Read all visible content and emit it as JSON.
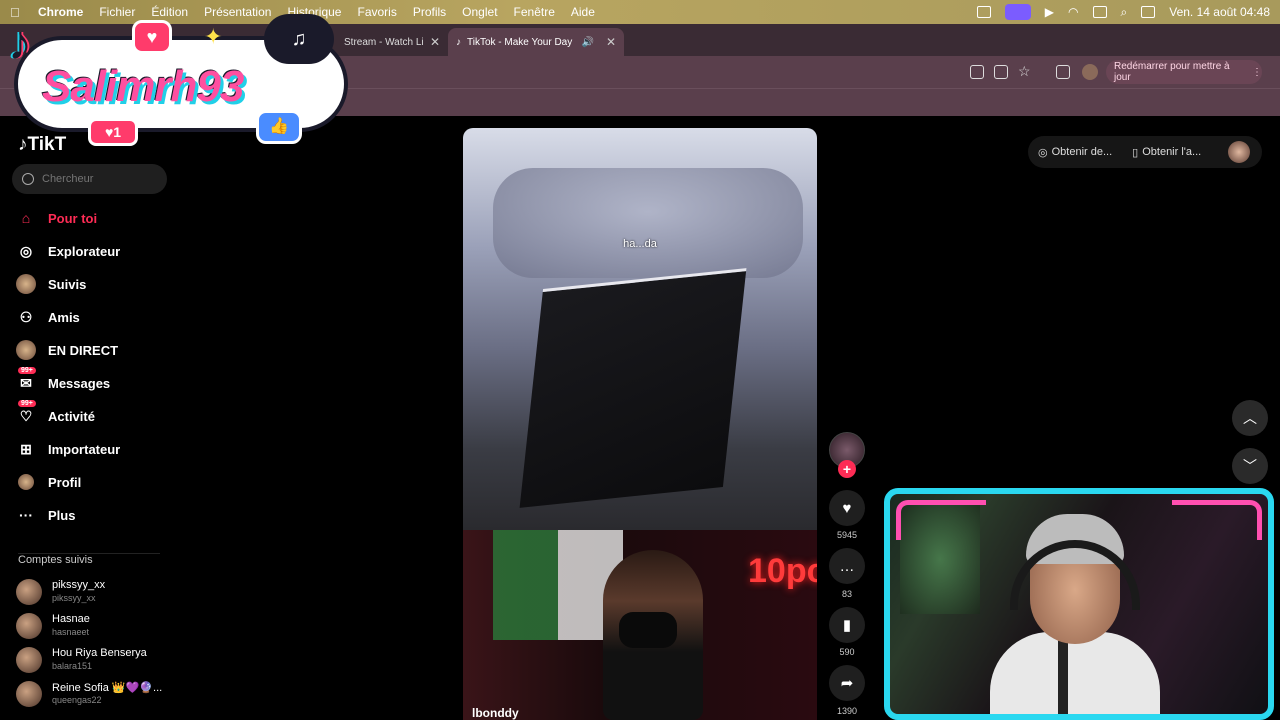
{
  "menubar": {
    "app": "Chrome",
    "items": [
      "Fichier",
      "Édition",
      "Présentation",
      "Historique",
      "Favoris",
      "Profils",
      "Onglet",
      "Fenêtre",
      "Aide"
    ],
    "clock": "Ven. 14 août  04:48"
  },
  "browser": {
    "tabs": [
      {
        "title": "Stream - Watch Li"
      },
      {
        "title": "TikTok - Make Your Day"
      }
    ],
    "relaunch_label": "Redémarrer pour mettre à jour"
  },
  "overlay": {
    "streamer_name": "Salimrh93",
    "like_count": "1"
  },
  "tiktok": {
    "logo": "TikT",
    "search_placeholder": "Chercheur",
    "nav": [
      {
        "label": "Pour toi",
        "icon": "home-icon"
      },
      {
        "label": "Explorateur",
        "icon": "compass-icon"
      },
      {
        "label": "Suivis",
        "icon": "following-avatar-icon"
      },
      {
        "label": "Amis",
        "icon": "friends-icon"
      },
      {
        "label": "EN DIRECT",
        "icon": "live-icon"
      },
      {
        "label": "Messages",
        "icon": "messages-icon",
        "badge": "99+"
      },
      {
        "label": "Activité",
        "icon": "activity-icon",
        "badge": "99+"
      },
      {
        "label": "Importateur",
        "icon": "upload-icon"
      },
      {
        "label": "Profil",
        "icon": "profile-icon"
      },
      {
        "label": "Plus",
        "icon": "more-icon"
      }
    ],
    "following_header": "Comptes suivis",
    "following": [
      {
        "name": "pikssyy_xx",
        "user": "pikssyy_xx"
      },
      {
        "name": "Hasnae",
        "user": "hasnaeet"
      },
      {
        "name": "Hou Riya Benserya",
        "user": "balara151"
      },
      {
        "name": "Reine Sofia 👑💜🔮...",
        "user": "queengas22"
      }
    ],
    "video": {
      "caption": "ha...da",
      "next_author": "lbonddy",
      "neon_text": "10pc"
    },
    "actions": {
      "likes": "5945",
      "comments": "83",
      "saves": "590",
      "shares": "1390"
    },
    "top_right": {
      "coins_label": "Obtenir de...",
      "app_label": "Obtenir l'a..."
    }
  },
  "colors": {
    "accent": "#fe2c55",
    "webcam_frame": "#2ad8f0",
    "webcam_corner": "#ff4fb0"
  }
}
